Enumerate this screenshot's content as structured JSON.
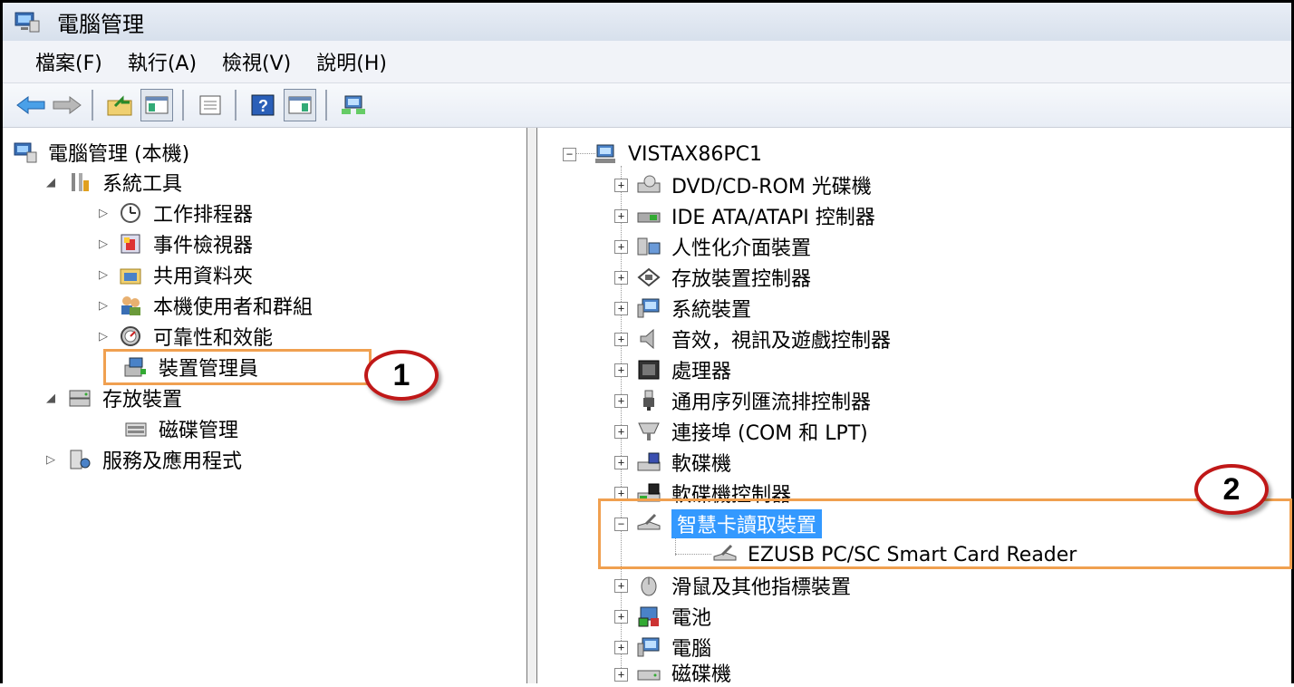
{
  "window": {
    "title": "電腦管理"
  },
  "menu": [
    "檔案(F)",
    "執行(A)",
    "檢視(V)",
    "說明(H)"
  ],
  "toolbar": {
    "buttons": [
      "back-icon",
      "forward-icon",
      "up-folder-icon",
      "show-hide-tree-icon",
      "properties-icon",
      "help-icon",
      "show-action-pane-icon",
      "computer-network-icon"
    ]
  },
  "left_tree": {
    "root": "電腦管理 (本機)",
    "system_tools": "系統工具",
    "task_scheduler": "工作排程器",
    "event_viewer": "事件檢視器",
    "shared_folders": "共用資料夾",
    "local_users": "本機使用者和群組",
    "reliability": "可靠性和效能",
    "device_manager": "裝置管理員",
    "storage": "存放裝置",
    "disk_management": "磁碟管理",
    "services_apps": "服務及應用程式"
  },
  "right_tree": {
    "root": "VISTAX86PC1",
    "items": [
      "DVD/CD-ROM 光碟機",
      "IDE ATA/ATAPI 控制器",
      "人性化介面裝置",
      "存放裝置控制器",
      "系統裝置",
      "音效，視訊及遊戲控制器",
      "處理器",
      "通用序列匯流排控制器",
      "連接埠 (COM 和 LPT)",
      "軟碟機",
      "軟碟機控制器",
      "智慧卡讀取裝置",
      "EZUSB PC/SC Smart Card Reader",
      "滑鼠及其他指標裝置",
      "電池",
      "電腦",
      "磁碟機"
    ]
  },
  "callouts": {
    "one": "1",
    "two": "2"
  },
  "colors": {
    "highlight_box": "#f0a050",
    "selection": "#3399ff",
    "callout_border": "#c01818"
  }
}
